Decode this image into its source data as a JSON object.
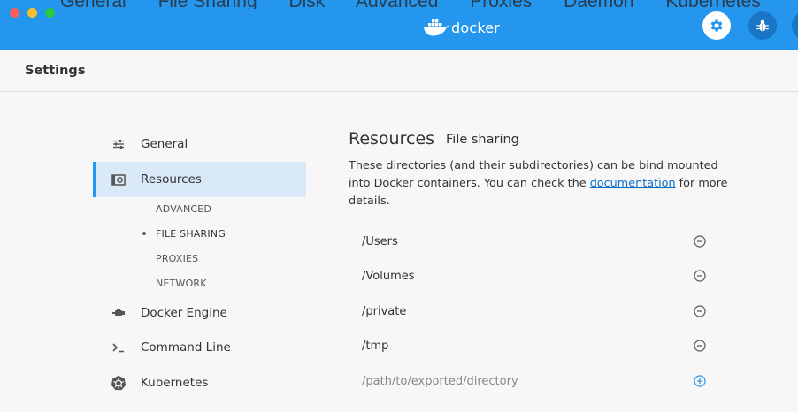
{
  "background_tabs": [
    "General",
    "File Sharing",
    "Disk",
    "Advanced",
    "Proxies",
    "Daemon",
    "Kubernetes"
  ],
  "titlebar": {
    "logo_text": "docker",
    "accent_color": "#2496ed",
    "gear_icon": "gear-icon",
    "bug_icon": "bug-icon"
  },
  "header": {
    "title": "Settings"
  },
  "sidebar": {
    "items": [
      {
        "label": "General",
        "icon": "sliders-icon"
      },
      {
        "label": "Resources",
        "icon": "resources-icon",
        "active": true
      },
      {
        "label": "Docker Engine",
        "icon": "engine-icon"
      },
      {
        "label": "Command Line",
        "icon": "terminal-icon"
      },
      {
        "label": "Kubernetes",
        "icon": "kubernetes-icon"
      }
    ],
    "sub_items": [
      "ADVANCED",
      "FILE SHARING",
      "PROXIES",
      "NETWORK"
    ],
    "active_sub_item": "FILE SHARING"
  },
  "main": {
    "title": "Resources",
    "subtitle": "File sharing",
    "description_before_link": "These directories (and their subdirectories) can be bind mounted into Docker containers. You can check the ",
    "description_link": "documentation",
    "description_after_link": " for more details.",
    "directories": [
      "/Users",
      "/Volumes",
      "/private",
      "/tmp"
    ],
    "new_directory_placeholder": "/path/to/exported/directory"
  }
}
